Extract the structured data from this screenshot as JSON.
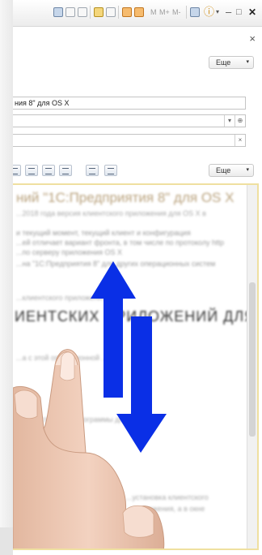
{
  "toolbar": {
    "m_label": "M",
    "mplus_label": "M+",
    "mminus_label": "M-"
  },
  "window": {
    "close_symbol": "×",
    "title_close": "✕",
    "title_minimize": "–",
    "title_maximize": "□"
  },
  "actions": {
    "more_label": "Еще",
    "more_label_2": "Еще",
    "arrow": "▾"
  },
  "fields": {
    "name_value": "ния 8\" для OS X",
    "field2_value": "",
    "field3_value": "",
    "field2_dropdown": "▾",
    "field2_link": "⊕",
    "field3_clear": "×"
  },
  "document": {
    "title": "ний \"1С:Предприятия 8\" для OS X",
    "lines": [
      "...2018 года версия клиентского приложения для OS X в",
      "и текущий момент, текущий клиент и конфигурация",
      "...ей отличает вариант фронта, в том числе по протоколу http",
      "...по серверу приложения OS X",
      "...на \"1С:Предприятия 8\" для других операционных систем",
      "...клиентского приложения",
      "...а с этой операционной ...ть",
      "...ьная структура программы для",
      "...ий для",
      "...приложений базой.",
      "...установка клиентского",
      "...приложения, а в окне"
    ],
    "heading": "ИЕНТСКИХ ПРИЛОЖЕНИЙ ДЛЯ"
  },
  "colors": {
    "arrow_blue": "#0a2fe6",
    "doc_border": "#efe0a0",
    "title_color": "#b9a27d"
  }
}
